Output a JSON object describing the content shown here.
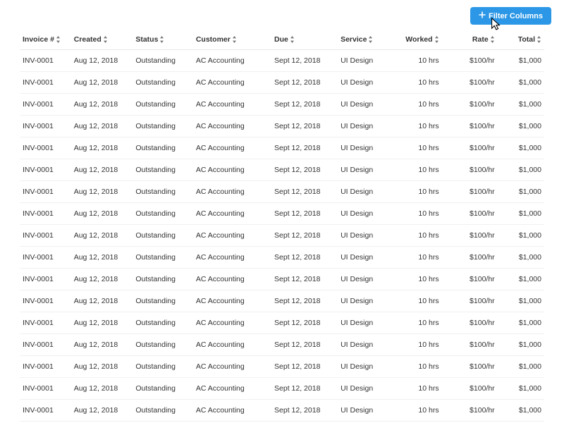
{
  "toolbar": {
    "filter_label": "Filter Columns"
  },
  "columns": [
    {
      "key": "invoice",
      "label": "Invoice #",
      "align": "left"
    },
    {
      "key": "created",
      "label": "Created",
      "align": "left"
    },
    {
      "key": "status",
      "label": "Status",
      "align": "left"
    },
    {
      "key": "customer",
      "label": "Customer",
      "align": "left"
    },
    {
      "key": "due",
      "label": "Due",
      "align": "left"
    },
    {
      "key": "service",
      "label": "Service",
      "align": "left"
    },
    {
      "key": "worked",
      "label": "Worked",
      "align": "right"
    },
    {
      "key": "rate",
      "label": "Rate",
      "align": "right"
    },
    {
      "key": "total",
      "label": "Total",
      "align": "right"
    }
  ],
  "rows": [
    {
      "invoice": "INV-0001",
      "created": "Aug 12, 2018",
      "status": "Outstanding",
      "customer": "AC Accounting",
      "due": "Sept 12, 2018",
      "service": "UI Design",
      "worked": "10 hrs",
      "rate": "$100/hr",
      "total": "$1,000"
    },
    {
      "invoice": "INV-0001",
      "created": "Aug 12, 2018",
      "status": "Outstanding",
      "customer": "AC Accounting",
      "due": "Sept 12, 2018",
      "service": "UI Design",
      "worked": "10 hrs",
      "rate": "$100/hr",
      "total": "$1,000"
    },
    {
      "invoice": "INV-0001",
      "created": "Aug 12, 2018",
      "status": "Outstanding",
      "customer": "AC Accounting",
      "due": "Sept 12, 2018",
      "service": "UI Design",
      "worked": "10 hrs",
      "rate": "$100/hr",
      "total": "$1,000"
    },
    {
      "invoice": "INV-0001",
      "created": "Aug 12, 2018",
      "status": "Outstanding",
      "customer": "AC Accounting",
      "due": "Sept 12, 2018",
      "service": "UI Design",
      "worked": "10 hrs",
      "rate": "$100/hr",
      "total": "$1,000"
    },
    {
      "invoice": "INV-0001",
      "created": "Aug 12, 2018",
      "status": "Outstanding",
      "customer": "AC Accounting",
      "due": "Sept 12, 2018",
      "service": "UI Design",
      "worked": "10 hrs",
      "rate": "$100/hr",
      "total": "$1,000"
    },
    {
      "invoice": "INV-0001",
      "created": "Aug 12, 2018",
      "status": "Outstanding",
      "customer": "AC Accounting",
      "due": "Sept 12, 2018",
      "service": "UI Design",
      "worked": "10 hrs",
      "rate": "$100/hr",
      "total": "$1,000"
    },
    {
      "invoice": "INV-0001",
      "created": "Aug 12, 2018",
      "status": "Outstanding",
      "customer": "AC Accounting",
      "due": "Sept 12, 2018",
      "service": "UI Design",
      "worked": "10 hrs",
      "rate": "$100/hr",
      "total": "$1,000"
    },
    {
      "invoice": "INV-0001",
      "created": "Aug 12, 2018",
      "status": "Outstanding",
      "customer": "AC Accounting",
      "due": "Sept 12, 2018",
      "service": "UI Design",
      "worked": "10 hrs",
      "rate": "$100/hr",
      "total": "$1,000"
    },
    {
      "invoice": "INV-0001",
      "created": "Aug 12, 2018",
      "status": "Outstanding",
      "customer": "AC Accounting",
      "due": "Sept 12, 2018",
      "service": "UI Design",
      "worked": "10 hrs",
      "rate": "$100/hr",
      "total": "$1,000"
    },
    {
      "invoice": "INV-0001",
      "created": "Aug 12, 2018",
      "status": "Outstanding",
      "customer": "AC Accounting",
      "due": "Sept 12, 2018",
      "service": "UI Design",
      "worked": "10 hrs",
      "rate": "$100/hr",
      "total": "$1,000"
    },
    {
      "invoice": "INV-0001",
      "created": "Aug 12, 2018",
      "status": "Outstanding",
      "customer": "AC Accounting",
      "due": "Sept 12, 2018",
      "service": "UI Design",
      "worked": "10 hrs",
      "rate": "$100/hr",
      "total": "$1,000"
    },
    {
      "invoice": "INV-0001",
      "created": "Aug 12, 2018",
      "status": "Outstanding",
      "customer": "AC Accounting",
      "due": "Sept 12, 2018",
      "service": "UI Design",
      "worked": "10 hrs",
      "rate": "$100/hr",
      "total": "$1,000"
    },
    {
      "invoice": "INV-0001",
      "created": "Aug 12, 2018",
      "status": "Outstanding",
      "customer": "AC Accounting",
      "due": "Sept 12, 2018",
      "service": "UI Design",
      "worked": "10 hrs",
      "rate": "$100/hr",
      "total": "$1,000"
    },
    {
      "invoice": "INV-0001",
      "created": "Aug 12, 2018",
      "status": "Outstanding",
      "customer": "AC Accounting",
      "due": "Sept 12, 2018",
      "service": "UI Design",
      "worked": "10 hrs",
      "rate": "$100/hr",
      "total": "$1,000"
    },
    {
      "invoice": "INV-0001",
      "created": "Aug 12, 2018",
      "status": "Outstanding",
      "customer": "AC Accounting",
      "due": "Sept 12, 2018",
      "service": "UI Design",
      "worked": "10 hrs",
      "rate": "$100/hr",
      "total": "$1,000"
    },
    {
      "invoice": "INV-0001",
      "created": "Aug 12, 2018",
      "status": "Outstanding",
      "customer": "AC Accounting",
      "due": "Sept 12, 2018",
      "service": "UI Design",
      "worked": "10 hrs",
      "rate": "$100/hr",
      "total": "$1,000"
    },
    {
      "invoice": "INV-0001",
      "created": "Aug 12, 2018",
      "status": "Outstanding",
      "customer": "AC Accounting",
      "due": "Sept 12, 2018",
      "service": "UI Design",
      "worked": "10 hrs",
      "rate": "$100/hr",
      "total": "$1,000"
    }
  ]
}
